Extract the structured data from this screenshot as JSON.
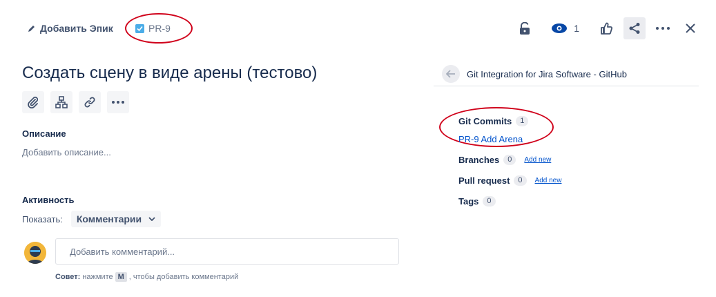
{
  "header": {
    "add_epic_label": "Добавить Эпик",
    "issue_key": "PR-9",
    "watch_count": "1"
  },
  "issue": {
    "title": "Создать сцену в виде арены (тестово)",
    "description_heading": "Описание",
    "description_placeholder": "Добавить описание...",
    "activity_heading": "Активность",
    "show_label": "Показать:",
    "show_value": "Комментарии",
    "comment_placeholder": "Добавить комментарий...",
    "tip_prefix": "Совет:",
    "tip_middle": "нажмите",
    "tip_key": "M",
    "tip_suffix": ", чтобы добавить комментарий"
  },
  "panel": {
    "title": "Git Integration for Jira Software - GitHub",
    "commits_label": "Git Commits",
    "commits_count": "1",
    "commit_link": "PR-9 Add Arena",
    "branches_label": "Branches",
    "branches_count": "0",
    "branches_add": "Add new",
    "pr_label": "Pull request",
    "pr_count": "0",
    "pr_add": "Add new",
    "tags_label": "Tags",
    "tags_count": "0"
  },
  "colors": {
    "link": "#0052cc",
    "annotation": "#d0021b",
    "accent": "#4bade8"
  }
}
